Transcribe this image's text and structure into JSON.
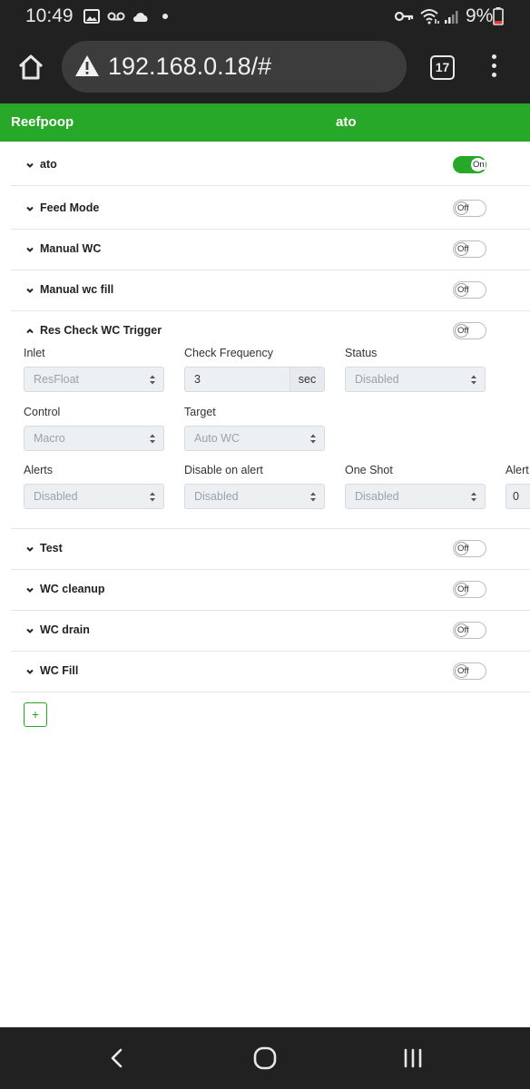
{
  "status_bar": {
    "time": "10:49",
    "battery": "9%",
    "icons": [
      "image-icon",
      "voicemail-icon",
      "cloud-icon",
      "dot-icon",
      "key-icon",
      "wifi-icon",
      "signal-icon",
      "battery-icon"
    ]
  },
  "browser": {
    "url": "192.168.0.18/#",
    "tab_count": "17",
    "icons": [
      "home-icon",
      "warning-icon",
      "tabs-icon",
      "overflow-menu-icon"
    ]
  },
  "app_header": {
    "brand": "Reefpoop",
    "page_title": "ato",
    "color": "#28a828"
  },
  "macros": [
    {
      "label": "ato",
      "state": "On"
    },
    {
      "label": "Feed Mode",
      "state": "Off"
    },
    {
      "label": "Manual WC",
      "state": "Off"
    },
    {
      "label": "Manual wc fill",
      "state": "Off"
    },
    {
      "label": "Res Check WC Trigger",
      "state": "Off"
    },
    {
      "label": "Test",
      "state": "Off"
    },
    {
      "label": "WC cleanup",
      "state": "Off"
    },
    {
      "label": "WC drain",
      "state": "Off"
    },
    {
      "label": "WC Fill",
      "state": "Off"
    }
  ],
  "expanded": {
    "inlet": {
      "label": "Inlet",
      "value": "ResFloat"
    },
    "check_frequency": {
      "label": "Check Frequency",
      "value": "3",
      "unit": "sec"
    },
    "status": {
      "label": "Status",
      "value": "Disabled"
    },
    "control": {
      "label": "Control",
      "value": "Macro"
    },
    "target": {
      "label": "Target",
      "value": "Auto WC"
    },
    "alerts": {
      "label": "Alerts",
      "value": "Disabled"
    },
    "disable_on_alert": {
      "label": "Disable on alert",
      "value": "Disabled"
    },
    "one_shot": {
      "label": "One Shot",
      "value": "Disabled"
    },
    "alert_cut": {
      "label": "Alert",
      "value": "0"
    }
  },
  "add_button": "+"
}
